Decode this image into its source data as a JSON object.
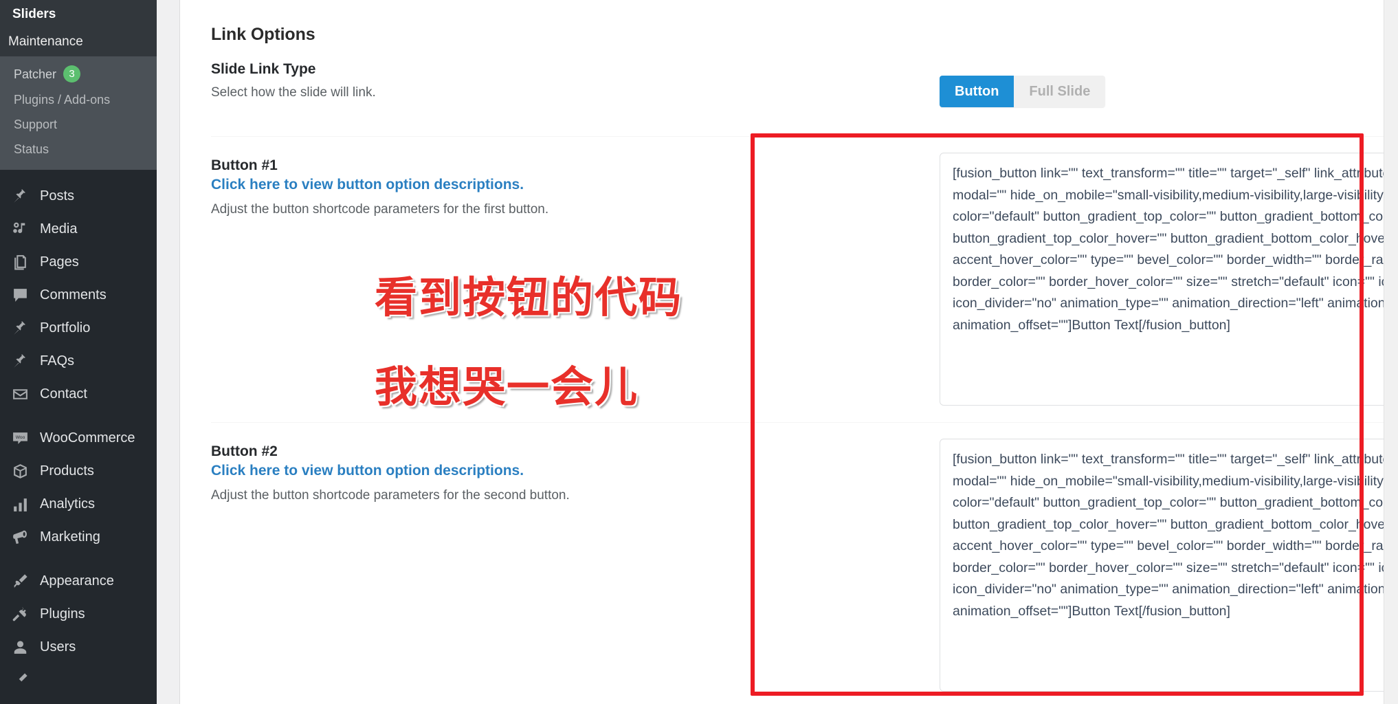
{
  "sidebar": {
    "title": "Sliders",
    "parent_item": "Maintenance",
    "submenu": [
      {
        "label": "Patcher",
        "badge": "3"
      },
      {
        "label": "Plugins / Add-ons",
        "badge": ""
      },
      {
        "label": "Support",
        "badge": ""
      },
      {
        "label": "Status",
        "badge": ""
      }
    ],
    "items": [
      {
        "label": "Posts",
        "icon": "pin-icon"
      },
      {
        "label": "Media",
        "icon": "media-icon"
      },
      {
        "label": "Pages",
        "icon": "pages-icon"
      },
      {
        "label": "Comments",
        "icon": "comment-icon"
      },
      {
        "label": "Portfolio",
        "icon": "pin-icon"
      },
      {
        "label": "FAQs",
        "icon": "pin-icon"
      },
      {
        "label": "Contact",
        "icon": "envelope-icon"
      },
      {
        "label": "WooCommerce",
        "icon": "woocommerce-icon"
      },
      {
        "label": "Products",
        "icon": "box-icon"
      },
      {
        "label": "Analytics",
        "icon": "bar-chart-icon"
      },
      {
        "label": "Marketing",
        "icon": "megaphone-icon"
      },
      {
        "label": "Appearance",
        "icon": "paintbrush-icon"
      },
      {
        "label": "Plugins",
        "icon": "plug-icon"
      },
      {
        "label": "Users",
        "icon": "user-icon"
      }
    ],
    "badge_color": "#5cbf6f"
  },
  "main": {
    "panel_title": "Link Options",
    "slide_link_type": {
      "label": "Slide Link Type",
      "description": "Select how the slide will link.",
      "options": [
        "Button",
        "Full Slide"
      ],
      "selected": "Button",
      "active_color": "#1e8fd5"
    },
    "button1": {
      "label": "Button #1",
      "link": "Click here to view button option descriptions.",
      "description": "Adjust the button shortcode parameters for the first button.",
      "shortcode": "[fusion_button link=\"\" text_transform=\"\" title=\"\" target=\"_self\" link_attributes=\"\" alignment=\"\" modal=\"\" hide_on_mobile=\"small-visibility,medium-visibility,large-visibility\" class=\"\" id=\"\" color=\"default\" button_gradient_top_color=\"\" button_gradient_bottom_color=\"\" button_gradient_top_color_hover=\"\" button_gradient_bottom_color_hover=\"\" accent_color=\"\" accent_hover_color=\"\" type=\"\" bevel_color=\"\" border_width=\"\" border_radius=\"\" border_color=\"\" border_hover_color=\"\" size=\"\" stretch=\"default\" icon=\"\" icon_position=\"left\" icon_divider=\"no\" animation_type=\"\" animation_direction=\"left\" animation_speed=\"0.3\" animation_offset=\"\"]Button Text[/fusion_button]"
    },
    "button2": {
      "label": "Button #2",
      "link": "Click here to view button option descriptions.",
      "description": "Adjust the button shortcode parameters for the second button.",
      "shortcode": "[fusion_button link=\"\" text_transform=\"\" title=\"\" target=\"_self\" link_attributes=\"\" alignment=\"\" modal=\"\" hide_on_mobile=\"small-visibility,medium-visibility,large-visibility\" class=\"\" id=\"\" color=\"default\" button_gradient_top_color=\"\" button_gradient_bottom_color=\"\" button_gradient_top_color_hover=\"\" button_gradient_bottom_color_hover=\"\" accent_color=\"\" accent_hover_color=\"\" type=\"\" bevel_color=\"\" border_width=\"\" border_radius=\"\" border_color=\"\" border_hover_color=\"\" size=\"\" stretch=\"default\" icon=\"\" icon_position=\"left\" icon_divider=\"no\" animation_type=\"\" animation_direction=\"left\" animation_speed=\"0.3\" animation_offset=\"\"]Button Text[/fusion_button]"
    }
  },
  "annotations": {
    "highlight_color": "#ed1c24",
    "overlay_line1": "看到按钮的代码",
    "overlay_line2": "我想哭一会儿",
    "overlay_color": "#e8302a"
  }
}
